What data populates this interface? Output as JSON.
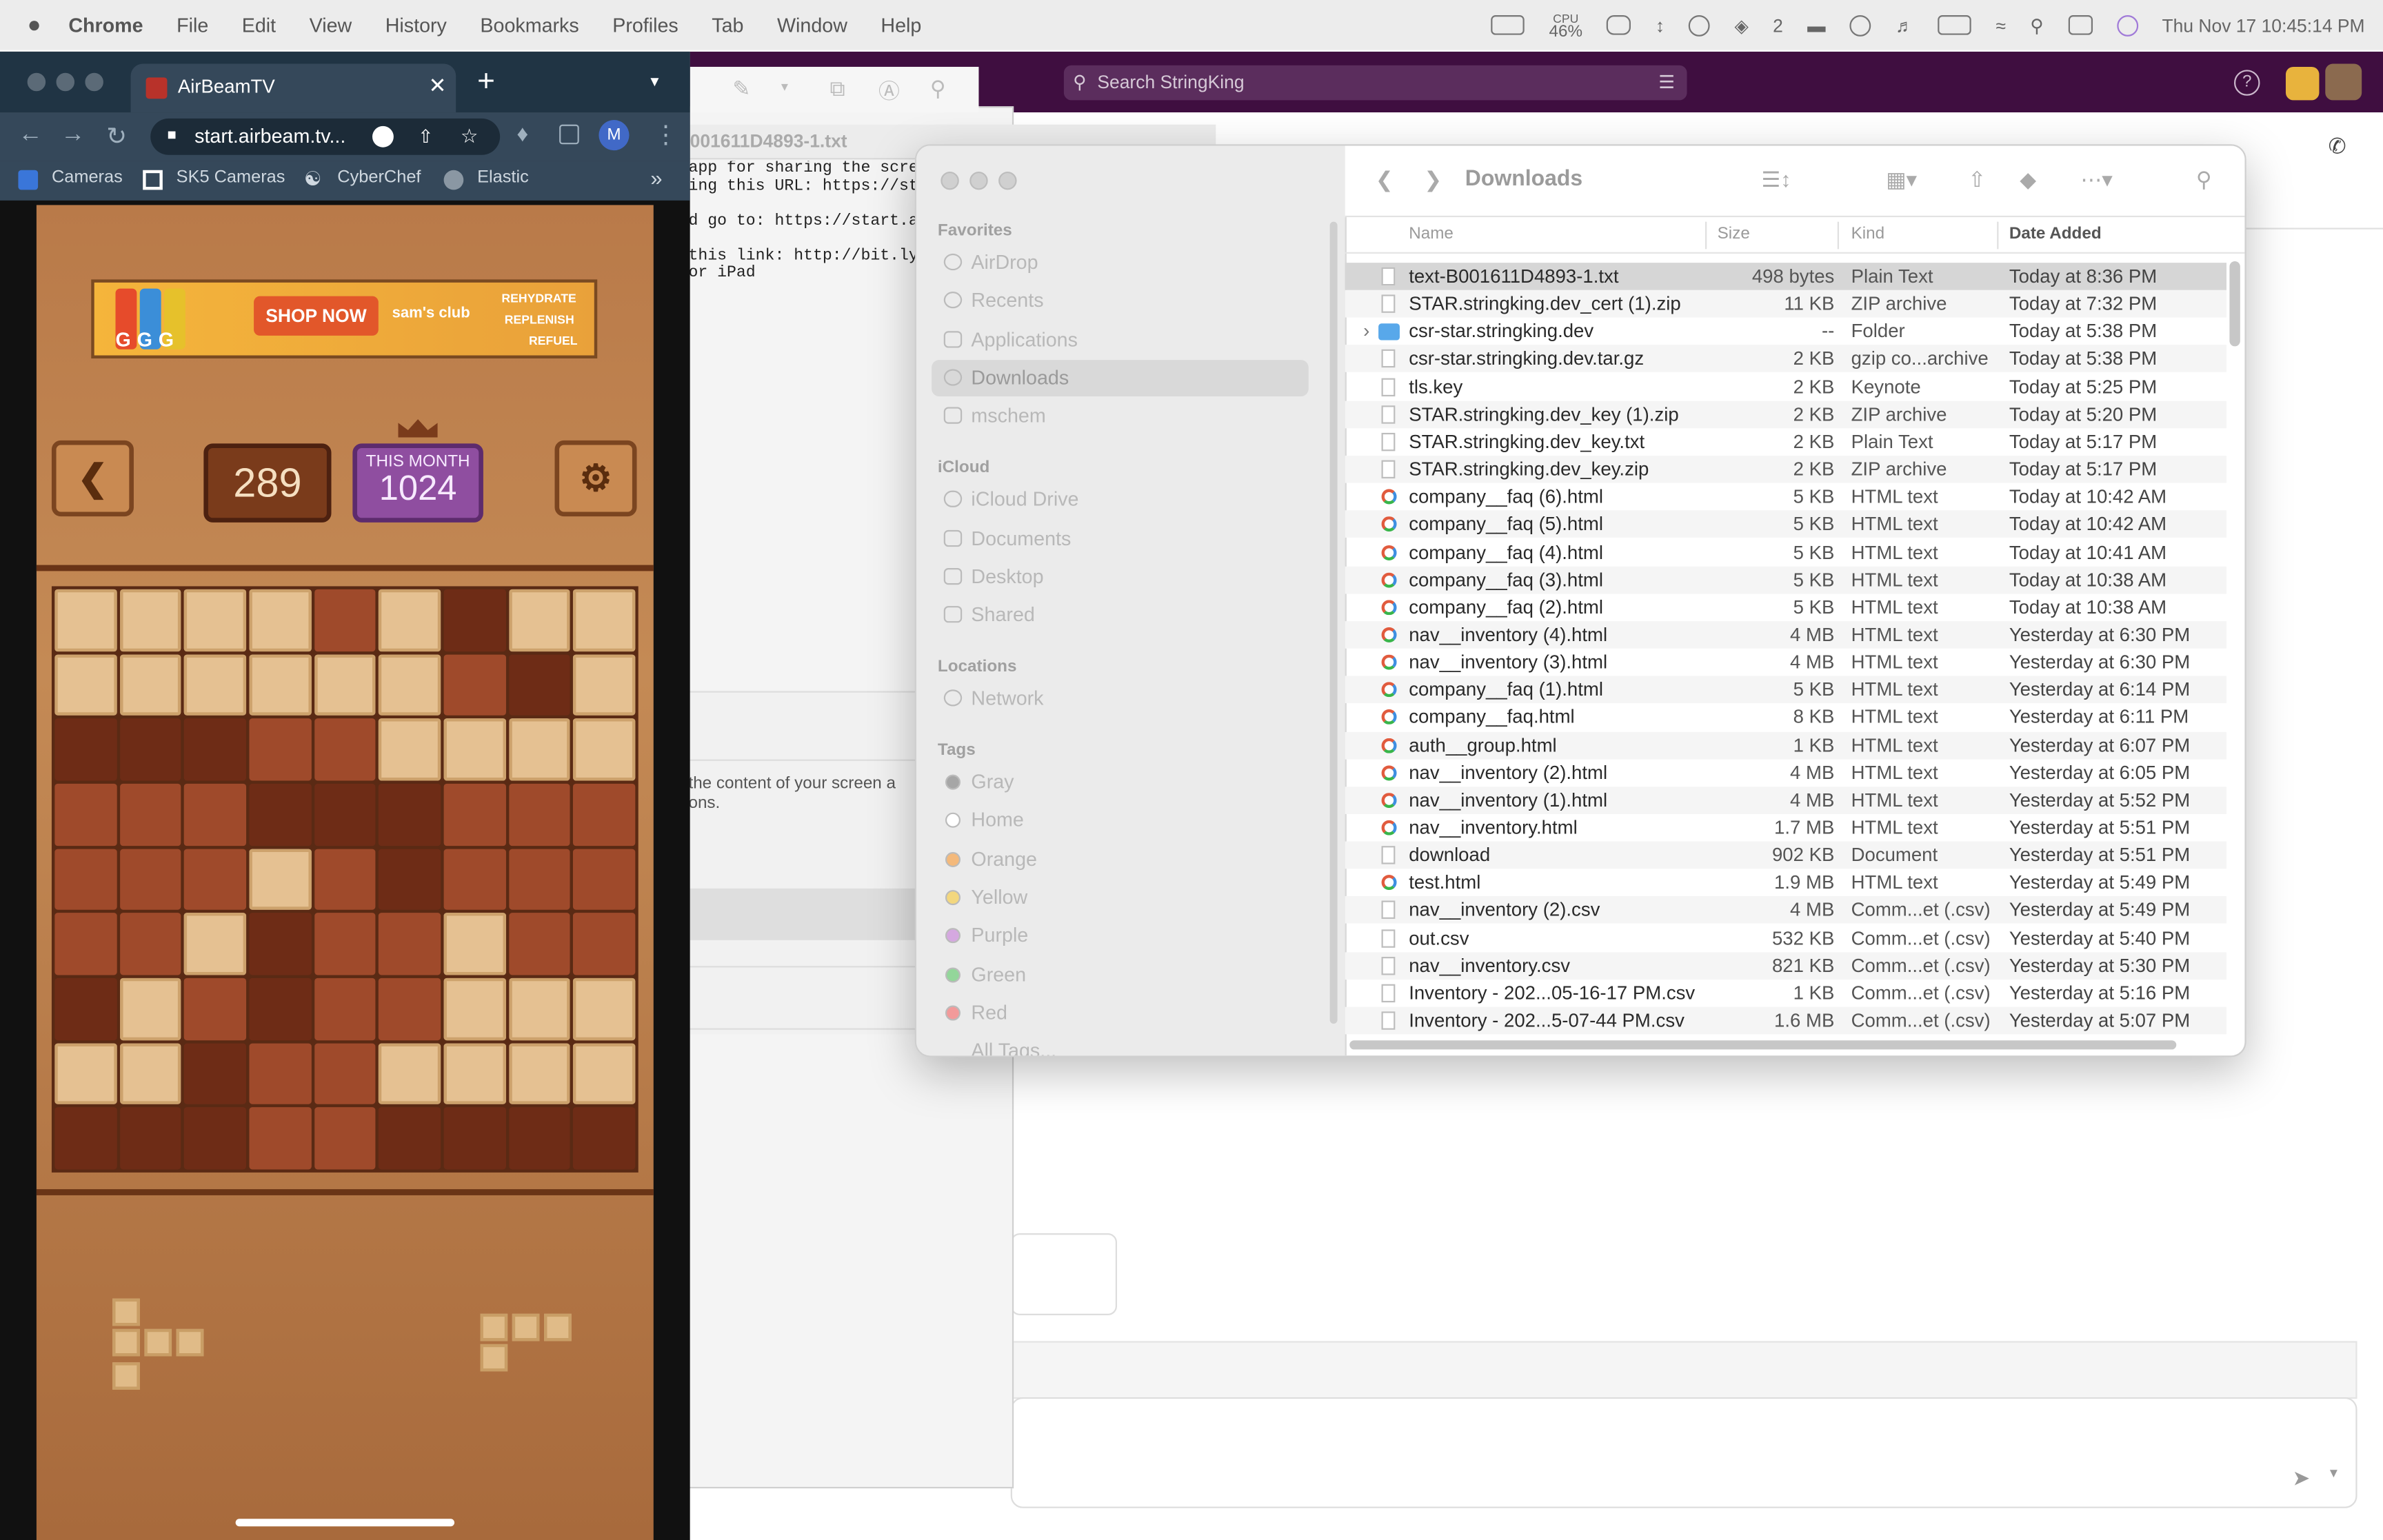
{
  "menubar": {
    "app": "Chrome",
    "items": [
      "File",
      "Edit",
      "View",
      "History",
      "Bookmarks",
      "Profiles",
      "Tab",
      "Window",
      "Help"
    ],
    "cpu": "CPU",
    "cpu_value": "46%",
    "chat_count": "2",
    "clock": "Thu Nov 17  10:45:14 PM"
  },
  "slack": {
    "search_placeholder": "Search StringKing"
  },
  "textedit": {
    "title": "001611D4893-1.txt",
    "text": "app for sharing the scre\ning this URL: https://sta\n\nd go to: https://start.a\n\nthis link: http://bit.ly/\nor iPad",
    "para": "the content of your screen a\nons."
  },
  "chrome": {
    "tab_title": "AirBeamTV",
    "url": "start.airbeam.tv...",
    "profile_initial": "M",
    "bookmarks": [
      "Cameras",
      "SK5 Cameras",
      "CyberChef",
      "Elastic"
    ],
    "overflow": "»"
  },
  "game": {
    "ad_brand": "GGG",
    "ad_cta": "SHOP NOW",
    "ad_store": "sam's club",
    "ad_tagline": [
      "REHYDRATE",
      "REPLENISH",
      "REFUEL"
    ],
    "score": "289",
    "month_label": "THIS MONTH",
    "month_score": "1024",
    "board": [
      [
        0,
        0,
        0,
        0,
        1,
        0,
        2,
        0,
        0
      ],
      [
        0,
        0,
        0,
        0,
        0,
        0,
        1,
        2,
        0
      ],
      [
        2,
        2,
        2,
        1,
        1,
        0,
        0,
        0,
        0
      ],
      [
        1,
        1,
        1,
        2,
        2,
        2,
        1,
        1,
        1
      ],
      [
        1,
        1,
        1,
        0,
        1,
        2,
        1,
        1,
        1
      ],
      [
        1,
        1,
        0,
        2,
        1,
        1,
        0,
        1,
        1
      ],
      [
        2,
        0,
        1,
        2,
        1,
        1,
        0,
        0,
        0
      ],
      [
        0,
        0,
        2,
        1,
        1,
        0,
        0,
        0,
        0
      ],
      [
        2,
        2,
        2,
        1,
        1,
        2,
        2,
        2,
        2
      ]
    ]
  },
  "finder": {
    "title": "Downloads",
    "sidebar": {
      "favorites_label": "Favorites",
      "favorites": [
        "AirDrop",
        "Recents",
        "Applications",
        "Downloads",
        "mschem"
      ],
      "icloud_label": "iCloud",
      "icloud": [
        "iCloud Drive",
        "Documents",
        "Desktop",
        "Shared"
      ],
      "locations_label": "Locations",
      "locations": [
        "Network"
      ],
      "tags_label": "Tags",
      "tags": [
        {
          "name": "Gray",
          "color": "#a6a6a6"
        },
        {
          "name": "Home",
          "color": "#ffffff"
        },
        {
          "name": "Orange",
          "color": "#f4b97b"
        },
        {
          "name": "Yellow",
          "color": "#f3d77e"
        },
        {
          "name": "Purple",
          "color": "#d5a8e0"
        },
        {
          "name": "Green",
          "color": "#93d69a"
        },
        {
          "name": "Red",
          "color": "#f29a9a"
        }
      ],
      "all_tags": "All Tags..."
    },
    "columns": {
      "name": "Name",
      "size": "Size",
      "kind": "Kind",
      "date": "Date Added"
    },
    "files": [
      {
        "name": "text-B001611D4893-1.txt",
        "size": "498 bytes",
        "kind": "Plain Text",
        "date": "Today at 8:36 PM",
        "icon": "doc"
      },
      {
        "name": "STAR.stringking.dev_cert (1).zip",
        "size": "11 KB",
        "kind": "ZIP archive",
        "date": "Today at 7:32 PM",
        "icon": "zip"
      },
      {
        "name": "csr-star.stringking.dev",
        "size": "--",
        "kind": "Folder",
        "date": "Today at 5:38 PM",
        "icon": "folder"
      },
      {
        "name": "csr-star.stringking.dev.tar.gz",
        "size": "2 KB",
        "kind": "gzip co...archive",
        "date": "Today at 5:38 PM",
        "icon": "zip"
      },
      {
        "name": "tls.key",
        "size": "2 KB",
        "kind": "Keynote",
        "date": "Today at 5:25 PM",
        "icon": "doc"
      },
      {
        "name": "STAR.stringking.dev_key (1).zip",
        "size": "2 KB",
        "kind": "ZIP archive",
        "date": "Today at 5:20 PM",
        "icon": "zip"
      },
      {
        "name": "STAR.stringking.dev_key.txt",
        "size": "2 KB",
        "kind": "Plain Text",
        "date": "Today at 5:17 PM",
        "icon": "doc"
      },
      {
        "name": "STAR.stringking.dev_key.zip",
        "size": "2 KB",
        "kind": "ZIP archive",
        "date": "Today at 5:17 PM",
        "icon": "zip"
      },
      {
        "name": "company__faq (6).html",
        "size": "5 KB",
        "kind": "HTML text",
        "date": "Today at 10:42 AM",
        "icon": "chrome"
      },
      {
        "name": "company__faq (5).html",
        "size": "5 KB",
        "kind": "HTML text",
        "date": "Today at 10:42 AM",
        "icon": "chrome"
      },
      {
        "name": "company__faq (4).html",
        "size": "5 KB",
        "kind": "HTML text",
        "date": "Today at 10:41 AM",
        "icon": "chrome"
      },
      {
        "name": "company__faq (3).html",
        "size": "5 KB",
        "kind": "HTML text",
        "date": "Today at 10:38 AM",
        "icon": "chrome"
      },
      {
        "name": "company__faq (2).html",
        "size": "5 KB",
        "kind": "HTML text",
        "date": "Today at 10:38 AM",
        "icon": "chrome"
      },
      {
        "name": "nav__inventory (4).html",
        "size": "4 MB",
        "kind": "HTML text",
        "date": "Yesterday at 6:30 PM",
        "icon": "chrome"
      },
      {
        "name": "nav__inventory (3).html",
        "size": "4 MB",
        "kind": "HTML text",
        "date": "Yesterday at 6:30 PM",
        "icon": "chrome"
      },
      {
        "name": "company__faq (1).html",
        "size": "5 KB",
        "kind": "HTML text",
        "date": "Yesterday at 6:14 PM",
        "icon": "chrome"
      },
      {
        "name": "company__faq.html",
        "size": "8 KB",
        "kind": "HTML text",
        "date": "Yesterday at 6:11 PM",
        "icon": "chrome"
      },
      {
        "name": "auth__group.html",
        "size": "1 KB",
        "kind": "HTML text",
        "date": "Yesterday at 6:07 PM",
        "icon": "chrome"
      },
      {
        "name": "nav__inventory (2).html",
        "size": "4 MB",
        "kind": "HTML text",
        "date": "Yesterday at 6:05 PM",
        "icon": "chrome"
      },
      {
        "name": "nav__inventory (1).html",
        "size": "4 MB",
        "kind": "HTML text",
        "date": "Yesterday at 5:52 PM",
        "icon": "chrome"
      },
      {
        "name": "nav__inventory.html",
        "size": "1.7 MB",
        "kind": "HTML text",
        "date": "Yesterday at 5:51 PM",
        "icon": "chrome"
      },
      {
        "name": "download",
        "size": "902 KB",
        "kind": "Document",
        "date": "Yesterday at 5:51 PM",
        "icon": "doc"
      },
      {
        "name": "test.html",
        "size": "1.9 MB",
        "kind": "HTML text",
        "date": "Yesterday at 5:49 PM",
        "icon": "chrome"
      },
      {
        "name": "nav__inventory (2).csv",
        "size": "4 MB",
        "kind": "Comm...et (.csv)",
        "date": "Yesterday at 5:49 PM",
        "icon": "doc"
      },
      {
        "name": "out.csv",
        "size": "532 KB",
        "kind": "Comm...et (.csv)",
        "date": "Yesterday at 5:40 PM",
        "icon": "doc"
      },
      {
        "name": "nav__inventory.csv",
        "size": "821 KB",
        "kind": "Comm...et (.csv)",
        "date": "Yesterday at 5:30 PM",
        "icon": "doc"
      },
      {
        "name": "Inventory - 202...05-16-17 PM.csv",
        "size": "1 KB",
        "kind": "Comm...et (.csv)",
        "date": "Yesterday at 5:16 PM",
        "icon": "doc"
      },
      {
        "name": "Inventory - 202...5-07-44 PM.csv",
        "size": "1.6 MB",
        "kind": "Comm...et (.csv)",
        "date": "Yesterday at 5:07 PM",
        "icon": "doc"
      }
    ]
  }
}
